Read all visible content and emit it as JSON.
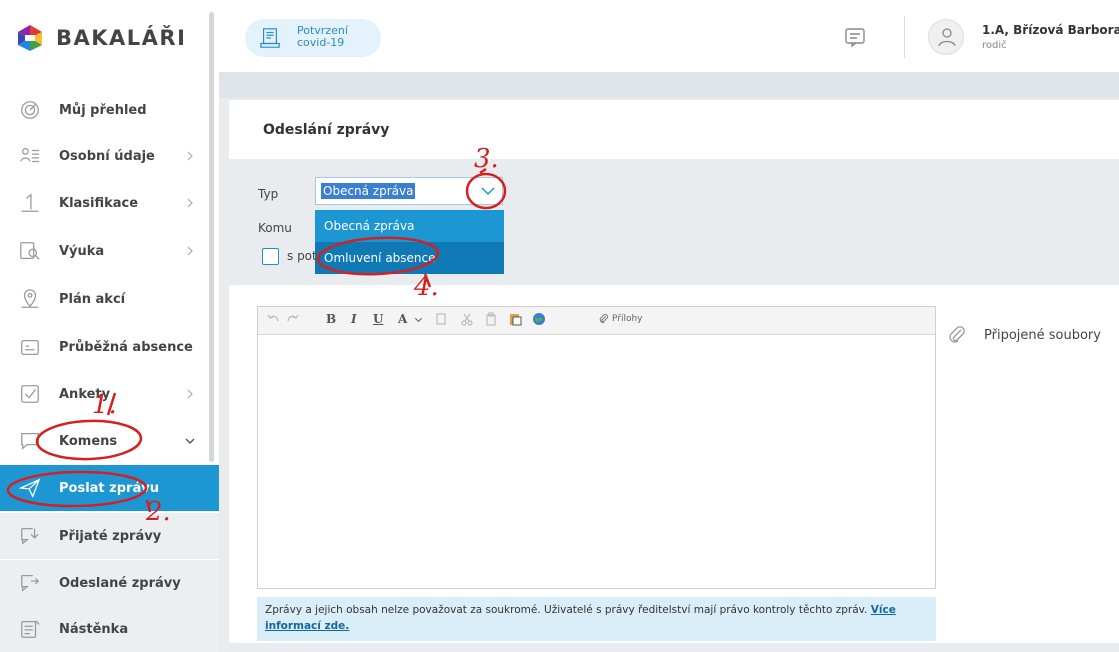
{
  "app": {
    "logo_text": "BAKALÁŘI"
  },
  "sidebar": {
    "items": [
      {
        "label": "Můj přehled",
        "icon": "target-icon"
      },
      {
        "label": "Osobní údaje",
        "icon": "id-card-icon"
      },
      {
        "label": "Klasifikace",
        "icon": "grade-one-icon"
      },
      {
        "label": "Výuka",
        "icon": "book-search-icon"
      },
      {
        "label": "Plán akcí",
        "icon": "map-pin-icon"
      },
      {
        "label": "Průběžná absence",
        "icon": "absence-icon"
      },
      {
        "label": "Ankety",
        "icon": "checkbox-icon"
      },
      {
        "label": "Komens",
        "icon": "chat-icon"
      },
      {
        "label": "Poslat zprávu",
        "icon": "send-icon"
      },
      {
        "label": "Přijaté zprávy",
        "icon": "inbox-icon"
      },
      {
        "label": "Odeslané zprávy",
        "icon": "outbox-icon"
      },
      {
        "label": "Nástěnka",
        "icon": "board-icon"
      }
    ]
  },
  "header": {
    "covid_line1": "Potvrzení",
    "covid_line2": "covid-19",
    "user_name": "1.A, Břízová Barbora",
    "user_role": "rodič"
  },
  "main": {
    "title": "Odeslání zprávy",
    "typ_label": "Typ",
    "komu_label": "Komu",
    "typ_value": "Obecná zpráva",
    "dropdown_options": [
      "Obecná zpráva",
      "Omluvení absence"
    ],
    "checkbox_label": "s pot",
    "toolbar_bold": "B",
    "toolbar_italic": "I",
    "toolbar_underline": "U",
    "toolbar_font_color": "A",
    "toolbar_attachments": "Přílohy",
    "attached_files": "Připojené soubory",
    "notice_text": "Zprávy a jejich obsah nelze považovat za soukromé. Uživatelé s právy ředitelství mají právo kontroly těchto zpráv.",
    "notice_link": "Více informací zde."
  },
  "annotations": [
    "1.",
    "2.",
    "3.",
    "4."
  ],
  "colors": {
    "accent": "#1d96d4",
    "annotation_red": "#d42020"
  }
}
